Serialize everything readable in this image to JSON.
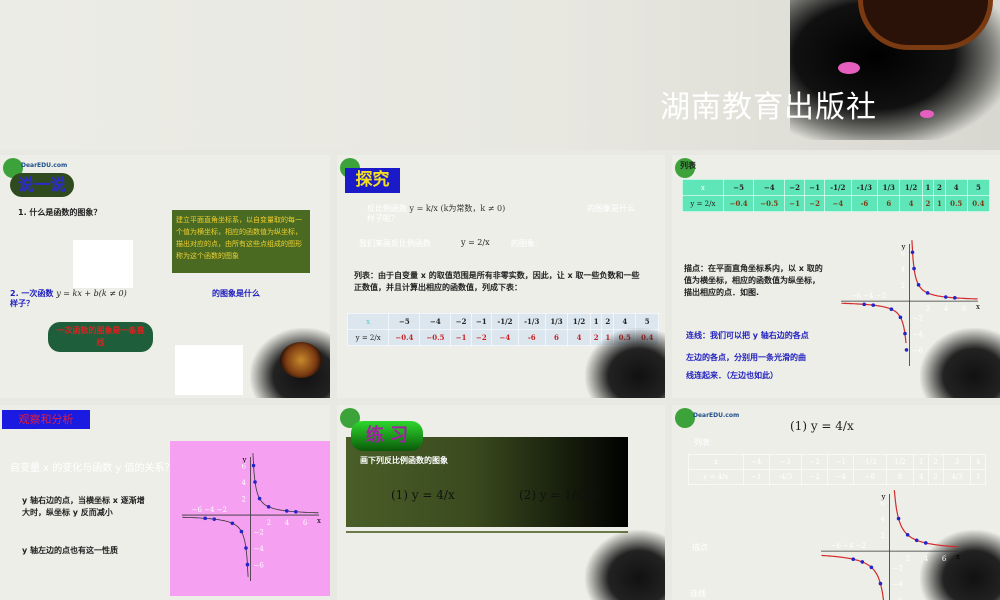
{
  "banner": {
    "title": "湖南教育出版社"
  },
  "logo": "DearEDU.com",
  "slide1": {
    "title": "说一说",
    "q1": "1. 什么是函数的图象？",
    "callout": "建立平面直角坐标系，以自变量取的每一个值为横坐标，相应的函数值为纵坐标，描出对应的点，由所有这些点组成的图形称为这个函数的图象",
    "q2_prefix": "2. 一次函数",
    "q2_formula": "y = kx + b(k ≠ 0)",
    "q2_suffix": "的图象是什么",
    "q2_tail": "样子？",
    "answer": "一次函数的图象是一条直线"
  },
  "slide2": {
    "title": "探究",
    "l1a": "反比例函数",
    "l1_formula": "y = k/x (k为常数，k ≠ 0)",
    "l1b": "的图象是什么",
    "l1c": "样子呢？",
    "l2a": "我们来画反比例函数",
    "l2_formula": "y = 2/x",
    "l2b": "的图象.",
    "para": "列表：由于自变量 x 的取值范围是所有非零实数，因此，让 x 取一些负数和一些正数值，并且计算出相应的函数值，列成下表："
  },
  "table2": {
    "x_label": "x",
    "y_label": "y = 2/x",
    "x": [
      "−5",
      "−4",
      "−2",
      "−1",
      "-1/2",
      "-1/3",
      "1/3",
      "1/2",
      "1",
      "2",
      "4",
      "5"
    ],
    "y": [
      "−0.4",
      "−0.5",
      "−1",
      "−2",
      "−4",
      "-6",
      "6",
      "4",
      "2",
      "1",
      "0.5",
      "0.4"
    ]
  },
  "slide3": {
    "label": "列表",
    "plot_text": "描点：在平面直角坐标系内，以 x 取的值为横坐标，相应的函数值为纵坐标，描出相应的点．如图.",
    "connect1": "连线：我们可以把 y 轴右边的各点",
    "connect2": "左边的各点，分别用一条光滑的曲",
    "connect3": "线连起来．（左边也如此）"
  },
  "slide4": {
    "title": "观察和分析",
    "question": "自变量 x 的变化与函数 y 值的关系？",
    "p1": "y 轴右边的点，当横坐标 x 逐渐增大时，纵坐标 y 反而减小",
    "p2": "y 轴左边的点也有这一性质"
  },
  "slide5": {
    "title": "练 习",
    "sub": "画下列反比例函数的图象",
    "f1": "(1)  y = 4/x",
    "f2": "(2)  y = 1/(2x)"
  },
  "slide6": {
    "formula": "(1)  y = 4/x",
    "label_table": "列表",
    "label_plot": "描点",
    "label_connect": "连线"
  },
  "table6": {
    "x_label": "x",
    "y_label": "y = 4/x",
    "x": [
      "−4",
      "−3",
      "−2",
      "−1",
      "-1/2",
      "1/2",
      "1",
      "2",
      "3",
      "4"
    ],
    "y": [
      "−1",
      "-4/3",
      "−2",
      "−4",
      "−8",
      "8",
      "4",
      "2",
      "4/3",
      "1"
    ]
  },
  "graph_ticks": {
    "x_neg": "−6 −4 −2",
    "x_pos": [
      "2",
      "4",
      "6"
    ],
    "y": [
      "6",
      "4",
      "2",
      "−2",
      "−4",
      "−6"
    ],
    "x_axis": "x",
    "y_axis": "y"
  },
  "graphs": {
    "g2": {
      "k": 2,
      "xs": [
        -5,
        -4,
        -2,
        -1,
        -0.5,
        -0.333,
        0.333,
        0.5,
        1,
        2,
        4,
        5
      ]
    },
    "g4": {
      "k": 4,
      "xs": [
        -4,
        -3,
        -2,
        -1,
        -0.5,
        0.5,
        1,
        2,
        3,
        4
      ]
    }
  },
  "colors": {
    "curve": "#d42a2a",
    "point": "#2424c8",
    "accent_blue": "#1a1ac8"
  }
}
